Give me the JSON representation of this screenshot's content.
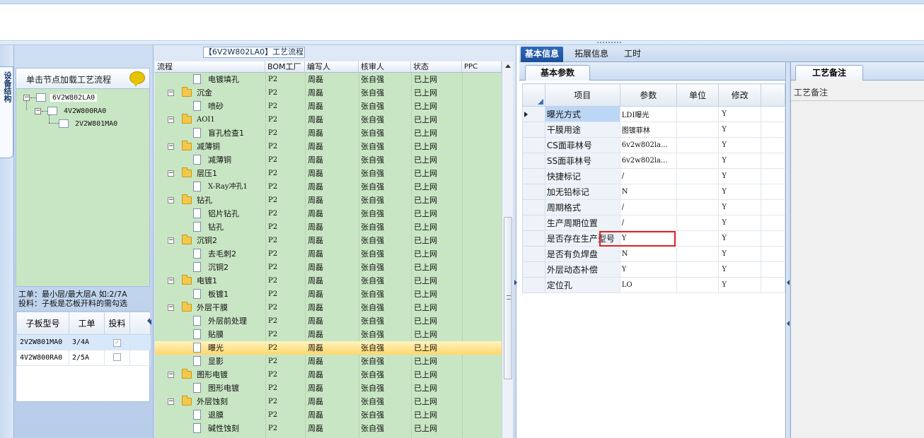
{
  "vtab_label": "设备结构",
  "left": {
    "header": "单击节点加载工艺流程",
    "tree": [
      {
        "label": "6V2W802LA0"
      },
      {
        "label": "4V2W800RA0"
      },
      {
        "label": "2V2W801MA0"
      }
    ],
    "info_line1": "工单：最小层/最大层A 如:2/7A",
    "info_line2": "投料：子板是芯板开料的需勾选",
    "grid_headers": [
      "子板型号",
      "工单",
      "投料"
    ],
    "grid_rows": [
      {
        "model": "2V2W801MA0",
        "order": "3/4A",
        "checked": true
      },
      {
        "model": "4V2W800RA0",
        "order": "2/5A",
        "checked": false
      }
    ]
  },
  "flow": {
    "title": "【6V2W802LA0】工艺流程",
    "headers": [
      "流程",
      "BOM工厂",
      "编写人",
      "核审人",
      "状态",
      "PPC"
    ],
    "rows": [
      {
        "name": "电镀填孔",
        "type": "doc",
        "level": 2,
        "factory": "P2",
        "writer": "周磊",
        "reviewer": "张自强",
        "status": "已上网"
      },
      {
        "name": "沉金",
        "type": "folder",
        "level": 1,
        "factory": "P2",
        "writer": "周磊",
        "reviewer": "张自强",
        "status": "已上网"
      },
      {
        "name": "喷砂",
        "type": "doc",
        "level": 2,
        "factory": "P2",
        "writer": "周磊",
        "reviewer": "张自强",
        "status": "已上网"
      },
      {
        "name": "AOI1",
        "type": "folder",
        "level": 1,
        "factory": "P2",
        "writer": "周磊",
        "reviewer": "张自强",
        "status": "已上网"
      },
      {
        "name": "盲孔检查1",
        "type": "doc",
        "level": 2,
        "factory": "P2",
        "writer": "周磊",
        "reviewer": "张自强",
        "status": "已上网"
      },
      {
        "name": "减薄铜",
        "type": "folder",
        "level": 1,
        "factory": "P2",
        "writer": "周磊",
        "reviewer": "张自强",
        "status": "已上网"
      },
      {
        "name": "减薄铜",
        "type": "doc",
        "level": 2,
        "factory": "P2",
        "writer": "周磊",
        "reviewer": "张自强",
        "status": "已上网"
      },
      {
        "name": "层压1",
        "type": "folder",
        "level": 1,
        "factory": "P2",
        "writer": "周磊",
        "reviewer": "张自强",
        "status": "已上网"
      },
      {
        "name": "X-Ray冲孔1",
        "type": "doc",
        "level": 2,
        "factory": "P2",
        "writer": "周磊",
        "reviewer": "张自强",
        "status": "已上网"
      },
      {
        "name": "钻孔",
        "type": "folder",
        "level": 1,
        "factory": "P2",
        "writer": "周磊",
        "reviewer": "张自强",
        "status": "已上网"
      },
      {
        "name": "铝片钻孔",
        "type": "doc",
        "level": 2,
        "factory": "P2",
        "writer": "周磊",
        "reviewer": "张自强",
        "status": "已上网"
      },
      {
        "name": "钻孔",
        "type": "doc",
        "level": 2,
        "factory": "P2",
        "writer": "周磊",
        "reviewer": "张自强",
        "status": "已上网"
      },
      {
        "name": "沉铜2",
        "type": "folder",
        "level": 1,
        "factory": "P2",
        "writer": "周磊",
        "reviewer": "张自强",
        "status": "已上网"
      },
      {
        "name": "去毛刺2",
        "type": "doc",
        "level": 2,
        "factory": "P2",
        "writer": "周磊",
        "reviewer": "张自强",
        "status": "已上网"
      },
      {
        "name": "沉铜2",
        "type": "doc",
        "level": 2,
        "factory": "P2",
        "writer": "周磊",
        "reviewer": "张自强",
        "status": "已上网"
      },
      {
        "name": "电镀1",
        "type": "folder",
        "level": 1,
        "factory": "P2",
        "writer": "周磊",
        "reviewer": "张自强",
        "status": "已上网"
      },
      {
        "name": "板镀1",
        "type": "doc",
        "level": 2,
        "factory": "P2",
        "writer": "周磊",
        "reviewer": "张自强",
        "status": "已上网"
      },
      {
        "name": "外层干膜",
        "type": "folder",
        "level": 1,
        "factory": "P2",
        "writer": "周磊",
        "reviewer": "张自强",
        "status": "已上网"
      },
      {
        "name": "外层前处理",
        "type": "doc",
        "level": 2,
        "factory": "P2",
        "writer": "周磊",
        "reviewer": "张自强",
        "status": "已上网"
      },
      {
        "name": "贴膜",
        "type": "doc",
        "level": 2,
        "factory": "P2",
        "writer": "周磊",
        "reviewer": "张自强",
        "status": "已上网"
      },
      {
        "name": "曝光",
        "type": "doc",
        "level": 2,
        "factory": "P2",
        "writer": "周磊",
        "reviewer": "张自强",
        "status": "已上网",
        "selected": true
      },
      {
        "name": "显影",
        "type": "doc",
        "level": 2,
        "factory": "P2",
        "writer": "周磊",
        "reviewer": "张自强",
        "status": "已上网"
      },
      {
        "name": "图形电镀",
        "type": "folder",
        "level": 1,
        "factory": "P2",
        "writer": "周磊",
        "reviewer": "张自强",
        "status": "已上网"
      },
      {
        "name": "图形电镀",
        "type": "doc",
        "level": 2,
        "factory": "P2",
        "writer": "周磊",
        "reviewer": "张自强",
        "status": "已上网"
      },
      {
        "name": "外层蚀刻",
        "type": "folder",
        "level": 1,
        "factory": "P2",
        "writer": "周磊",
        "reviewer": "张自强",
        "status": "已上网"
      },
      {
        "name": "退膜",
        "type": "doc",
        "level": 2,
        "factory": "P2",
        "writer": "周磊",
        "reviewer": "张自强",
        "status": "已上网"
      },
      {
        "name": "碱性蚀刻",
        "type": "doc",
        "level": 2,
        "factory": "P2",
        "writer": "周磊",
        "reviewer": "张自强",
        "status": "已上网"
      }
    ]
  },
  "right": {
    "tabs": [
      "基本信息",
      "拓展信息",
      "工时"
    ],
    "active_tab": 0,
    "subtab": "基本参数",
    "param_headers": [
      "项目",
      "参数",
      "单位",
      "修改"
    ],
    "params": [
      {
        "item": "曝光方式",
        "value": "LDI曝光",
        "unit": "",
        "mod": "Y",
        "magenta": true,
        "current": true
      },
      {
        "item": "干膜用途",
        "value": "图镀菲林",
        "unit": "",
        "mod": "Y",
        "magenta": true
      },
      {
        "item": "CS面菲林号",
        "value": "6v2w802la...",
        "unit": "",
        "mod": "Y"
      },
      {
        "item": "SS面菲林号",
        "value": "6v2w802la...",
        "unit": "",
        "mod": "Y"
      },
      {
        "item": "快捷标记",
        "value": "/",
        "unit": "",
        "mod": "Y"
      },
      {
        "item": "加无铅标记",
        "value": "N",
        "unit": "",
        "mod": "Y"
      },
      {
        "item": "周期格式",
        "value": "/",
        "unit": "",
        "mod": "Y"
      },
      {
        "item": "生产周期位置",
        "value": "/",
        "unit": "",
        "mod": "Y"
      },
      {
        "item": "是否存在生产型号",
        "value": "Y",
        "unit": "",
        "mod": "Y"
      },
      {
        "item": "是否有负焊盘",
        "value": "N",
        "unit": "",
        "mod": "Y"
      },
      {
        "item": "外层动态补偿",
        "value": "Y",
        "unit": "",
        "mod": "Y"
      },
      {
        "item": "定位孔",
        "value": "LO",
        "unit": "",
        "mod": "Y"
      }
    ],
    "notes_tab": "工艺备注",
    "notes_label": "工艺备注"
  },
  "colors": {
    "tree_bg": "#c9e6c4",
    "tab_active": "#1d4f97",
    "magenta_text": "#c0158e",
    "highlight_border": "#e02020",
    "selected_row": "#ffd76b"
  }
}
